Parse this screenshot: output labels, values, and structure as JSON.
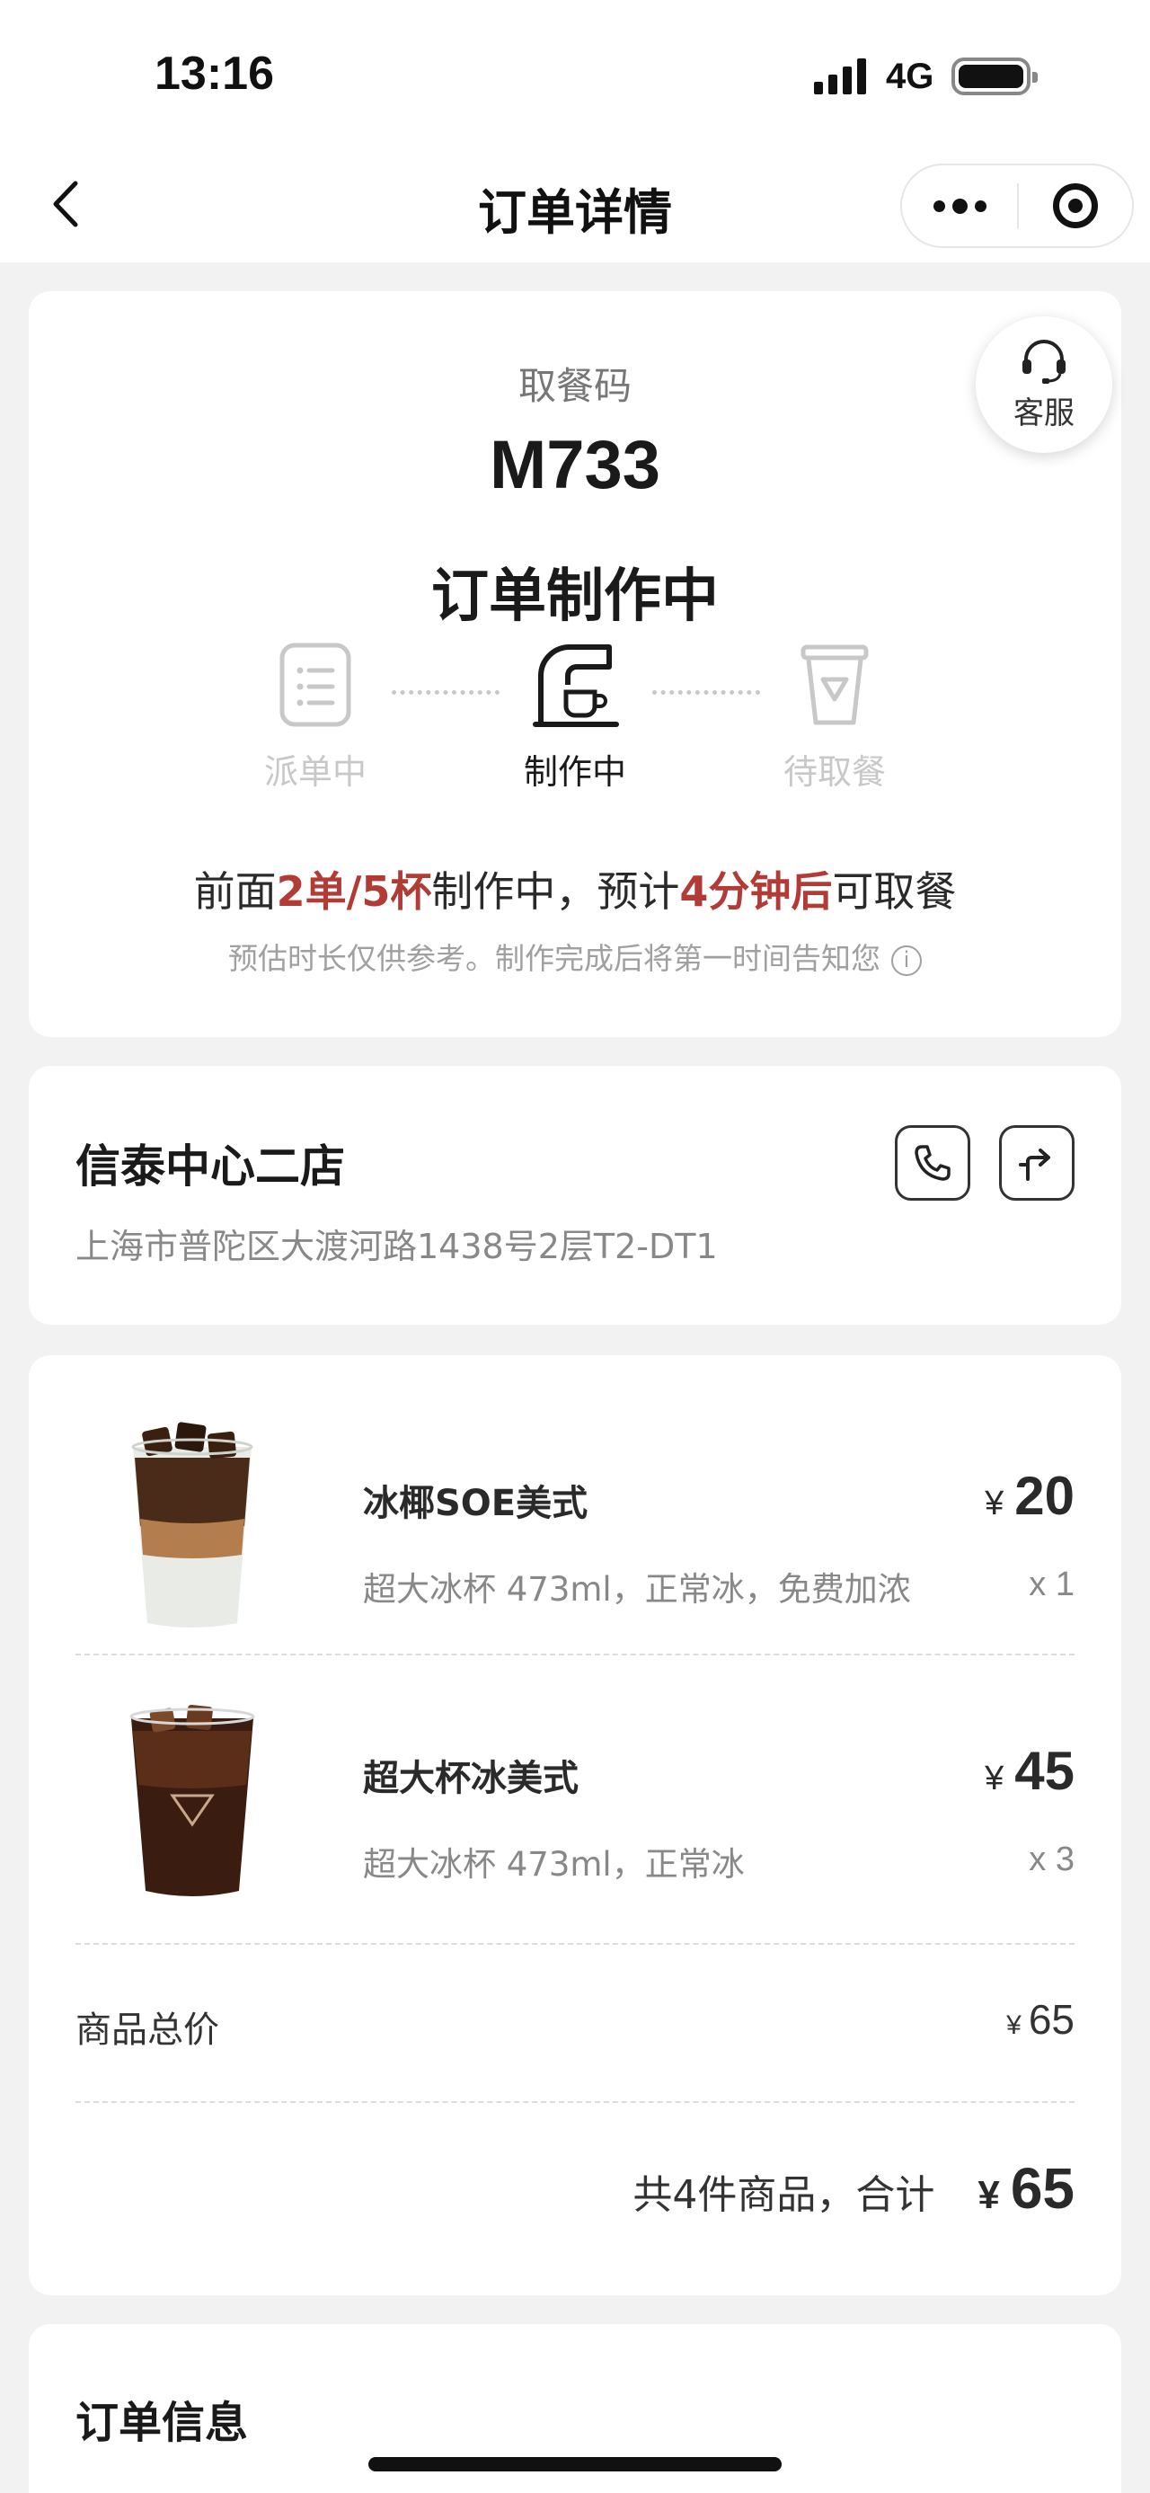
{
  "status_bar": {
    "time": "13:16",
    "network": "4G"
  },
  "nav": {
    "title": "订单详情"
  },
  "pickup": {
    "label": "取餐码",
    "code": "M733",
    "status": "订单制作中",
    "service_label": "客服",
    "steps": [
      {
        "label": "派单中",
        "active": false
      },
      {
        "label": "制作中",
        "active": true
      },
      {
        "label": "待取餐",
        "active": false
      }
    ],
    "progress": {
      "prefix": "前面",
      "queue": "2单/5杯",
      "middle": "制作中，预计",
      "eta": "4分钟后",
      "suffix": "可取餐"
    },
    "note": "预估时长仅供参考。制作完成后将第一时间告知您",
    "note_icon": "i"
  },
  "store": {
    "name": "信泰中心二店",
    "address": "上海市普陀区大渡河路1438号2层T2-DT1"
  },
  "items": [
    {
      "name": "冰椰SOE美式",
      "spec": "超大冰杯 473ml，正常冰，免费加浓",
      "currency": "¥",
      "price": "20",
      "qty": "x 1"
    },
    {
      "name": "超大杯冰美式",
      "spec": "超大冰杯 473ml，正常冰",
      "currency": "¥",
      "price": "45",
      "qty": "x 3"
    }
  ],
  "summary": {
    "subtotal_label": "商品总价",
    "subtotal_currency": "¥",
    "subtotal_value": "65",
    "total_text": "共4件商品，合计",
    "total_currency": "¥",
    "total_value": "65"
  },
  "order_info": {
    "title": "订单信息"
  },
  "colors": {
    "highlight": "#b23b35",
    "inactive": "#c8c8c8"
  }
}
